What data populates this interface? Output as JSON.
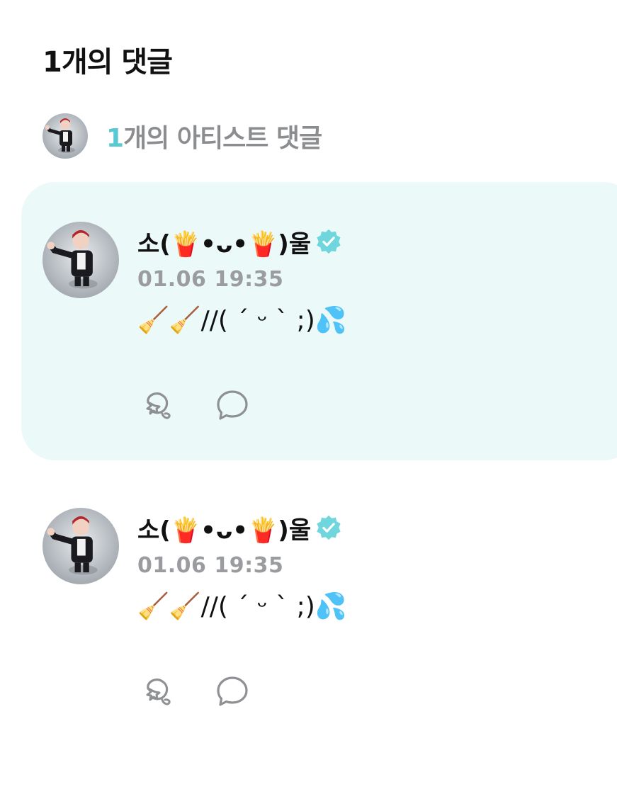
{
  "header": {
    "title": "1개의 댓글"
  },
  "artist_comments": {
    "count": "1",
    "label": "개의 아티스트 댓글"
  },
  "comments": [
    {
      "author": "소(🍟•ᴗ•🍟)울",
      "timestamp": "01.06 19:35",
      "text": "🧹🧹//( ´ ᵕ ` ;)💦",
      "highlighted": true
    },
    {
      "author": "소(🍟•ᴗ•🍟)울",
      "timestamp": "01.06 19:35",
      "text": "🧹🧹//( ´ ᵕ ` ;)💦",
      "highlighted": false
    }
  ],
  "icons": {
    "verified": "verified-badge-icon",
    "like": "cheer-like-icon",
    "reply": "speech-bubble-icon"
  },
  "colors": {
    "accent": "#57c9d2",
    "highlight_bg": "#ebfaf8",
    "muted_text": "#9a9c9f",
    "icon_stroke": "#8e9094"
  }
}
